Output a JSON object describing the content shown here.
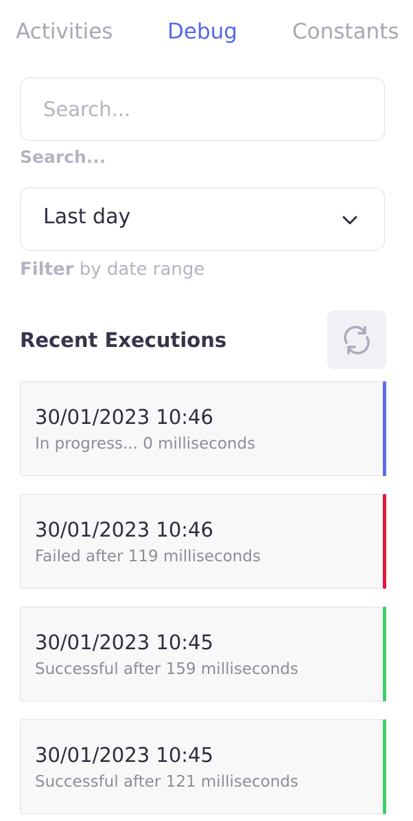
{
  "tabs": [
    {
      "label": "Activities",
      "active": false
    },
    {
      "label": "Debug",
      "active": true
    },
    {
      "label": "Constants",
      "active": false
    }
  ],
  "search": {
    "placeholder": "Search...",
    "value": "",
    "label": "Search..."
  },
  "date_filter": {
    "selected": "Last day",
    "hint_strong": "Filter",
    "hint_rest": " by date range",
    "icon": "chevron-down-icon"
  },
  "executions": {
    "title": "Recent Executions",
    "refresh_icon": "refresh-icon",
    "items": [
      {
        "date": "30/01/2023 10:46",
        "status": "In progress... 0 milliseconds",
        "state": "in-progress",
        "color": "#5b6ee8"
      },
      {
        "date": "30/01/2023 10:46",
        "status": "Failed after 119 milliseconds",
        "state": "failed",
        "color": "#e3173d"
      },
      {
        "date": "30/01/2023 10:45",
        "status": "Successful after 159 milliseconds",
        "state": "success",
        "color": "#3fcf6a"
      },
      {
        "date": "30/01/2023 10:45",
        "status": "Successful after 121 milliseconds",
        "state": "success",
        "color": "#3fcf6a"
      }
    ]
  },
  "colors": {
    "accent": "#5568e8",
    "muted_text": "#b4b4c2",
    "border": "#dfdfe9"
  }
}
